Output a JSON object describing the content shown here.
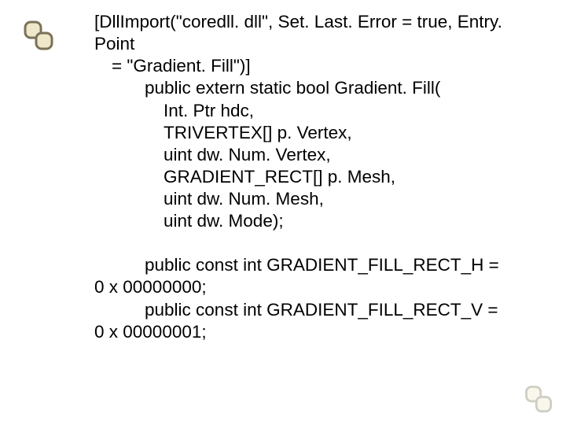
{
  "code": {
    "attr_line1": "[DllImport(\"coredll. dll\", Set. Last. Error = true, Entry. Point",
    "attr_line2": "= \"Gradient. Fill\")]",
    "decl": "public extern static bool Gradient. Fill(",
    "p1": "Int. Ptr hdc,",
    "p2": "TRIVERTEX[] p. Vertex,",
    "p3": "uint dw. Num. Vertex,",
    "p4": "GRADIENT_RECT[] p. Mesh,",
    "p5": "uint dw. Num. Mesh,",
    "p6": "uint dw. Mode);",
    "const_h_line1": "public const int GRADIENT_FILL_RECT_H =",
    "const_h_line2": "0 x 00000000;",
    "const_v_line1": "public const int GRADIENT_FILL_RECT_V =",
    "const_v_line2": "0 x 00000001;"
  },
  "icons": {
    "chain": "chain-link-icon",
    "backref": "chain-link-icon"
  }
}
